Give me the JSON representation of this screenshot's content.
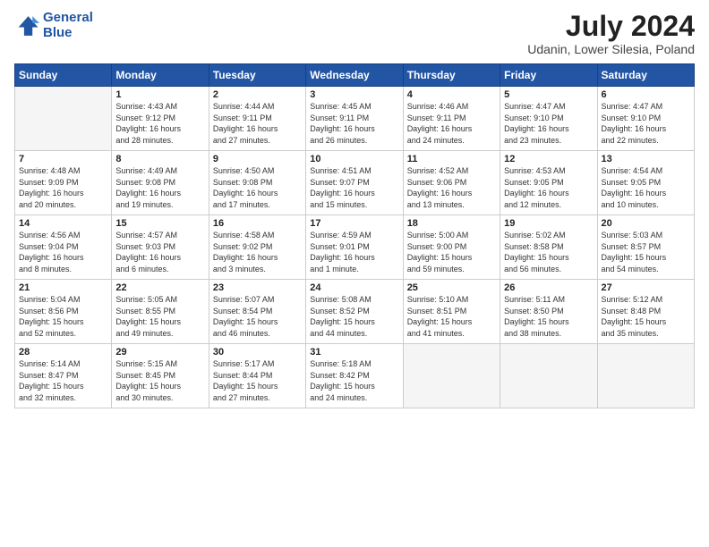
{
  "logo": {
    "line1": "General",
    "line2": "Blue"
  },
  "title": "July 2024",
  "subtitle": "Udanin, Lower Silesia, Poland",
  "days_header": [
    "Sunday",
    "Monday",
    "Tuesday",
    "Wednesday",
    "Thursday",
    "Friday",
    "Saturday"
  ],
  "weeks": [
    [
      {
        "day": "",
        "info": ""
      },
      {
        "day": "1",
        "info": "Sunrise: 4:43 AM\nSunset: 9:12 PM\nDaylight: 16 hours\nand 28 minutes."
      },
      {
        "day": "2",
        "info": "Sunrise: 4:44 AM\nSunset: 9:11 PM\nDaylight: 16 hours\nand 27 minutes."
      },
      {
        "day": "3",
        "info": "Sunrise: 4:45 AM\nSunset: 9:11 PM\nDaylight: 16 hours\nand 26 minutes."
      },
      {
        "day": "4",
        "info": "Sunrise: 4:46 AM\nSunset: 9:11 PM\nDaylight: 16 hours\nand 24 minutes."
      },
      {
        "day": "5",
        "info": "Sunrise: 4:47 AM\nSunset: 9:10 PM\nDaylight: 16 hours\nand 23 minutes."
      },
      {
        "day": "6",
        "info": "Sunrise: 4:47 AM\nSunset: 9:10 PM\nDaylight: 16 hours\nand 22 minutes."
      }
    ],
    [
      {
        "day": "7",
        "info": "Sunrise: 4:48 AM\nSunset: 9:09 PM\nDaylight: 16 hours\nand 20 minutes."
      },
      {
        "day": "8",
        "info": "Sunrise: 4:49 AM\nSunset: 9:08 PM\nDaylight: 16 hours\nand 19 minutes."
      },
      {
        "day": "9",
        "info": "Sunrise: 4:50 AM\nSunset: 9:08 PM\nDaylight: 16 hours\nand 17 minutes."
      },
      {
        "day": "10",
        "info": "Sunrise: 4:51 AM\nSunset: 9:07 PM\nDaylight: 16 hours\nand 15 minutes."
      },
      {
        "day": "11",
        "info": "Sunrise: 4:52 AM\nSunset: 9:06 PM\nDaylight: 16 hours\nand 13 minutes."
      },
      {
        "day": "12",
        "info": "Sunrise: 4:53 AM\nSunset: 9:05 PM\nDaylight: 16 hours\nand 12 minutes."
      },
      {
        "day": "13",
        "info": "Sunrise: 4:54 AM\nSunset: 9:05 PM\nDaylight: 16 hours\nand 10 minutes."
      }
    ],
    [
      {
        "day": "14",
        "info": "Sunrise: 4:56 AM\nSunset: 9:04 PM\nDaylight: 16 hours\nand 8 minutes."
      },
      {
        "day": "15",
        "info": "Sunrise: 4:57 AM\nSunset: 9:03 PM\nDaylight: 16 hours\nand 6 minutes."
      },
      {
        "day": "16",
        "info": "Sunrise: 4:58 AM\nSunset: 9:02 PM\nDaylight: 16 hours\nand 3 minutes."
      },
      {
        "day": "17",
        "info": "Sunrise: 4:59 AM\nSunset: 9:01 PM\nDaylight: 16 hours\nand 1 minute."
      },
      {
        "day": "18",
        "info": "Sunrise: 5:00 AM\nSunset: 9:00 PM\nDaylight: 15 hours\nand 59 minutes."
      },
      {
        "day": "19",
        "info": "Sunrise: 5:02 AM\nSunset: 8:58 PM\nDaylight: 15 hours\nand 56 minutes."
      },
      {
        "day": "20",
        "info": "Sunrise: 5:03 AM\nSunset: 8:57 PM\nDaylight: 15 hours\nand 54 minutes."
      }
    ],
    [
      {
        "day": "21",
        "info": "Sunrise: 5:04 AM\nSunset: 8:56 PM\nDaylight: 15 hours\nand 52 minutes."
      },
      {
        "day": "22",
        "info": "Sunrise: 5:05 AM\nSunset: 8:55 PM\nDaylight: 15 hours\nand 49 minutes."
      },
      {
        "day": "23",
        "info": "Sunrise: 5:07 AM\nSunset: 8:54 PM\nDaylight: 15 hours\nand 46 minutes."
      },
      {
        "day": "24",
        "info": "Sunrise: 5:08 AM\nSunset: 8:52 PM\nDaylight: 15 hours\nand 44 minutes."
      },
      {
        "day": "25",
        "info": "Sunrise: 5:10 AM\nSunset: 8:51 PM\nDaylight: 15 hours\nand 41 minutes."
      },
      {
        "day": "26",
        "info": "Sunrise: 5:11 AM\nSunset: 8:50 PM\nDaylight: 15 hours\nand 38 minutes."
      },
      {
        "day": "27",
        "info": "Sunrise: 5:12 AM\nSunset: 8:48 PM\nDaylight: 15 hours\nand 35 minutes."
      }
    ],
    [
      {
        "day": "28",
        "info": "Sunrise: 5:14 AM\nSunset: 8:47 PM\nDaylight: 15 hours\nand 32 minutes."
      },
      {
        "day": "29",
        "info": "Sunrise: 5:15 AM\nSunset: 8:45 PM\nDaylight: 15 hours\nand 30 minutes."
      },
      {
        "day": "30",
        "info": "Sunrise: 5:17 AM\nSunset: 8:44 PM\nDaylight: 15 hours\nand 27 minutes."
      },
      {
        "day": "31",
        "info": "Sunrise: 5:18 AM\nSunset: 8:42 PM\nDaylight: 15 hours\nand 24 minutes."
      },
      {
        "day": "",
        "info": ""
      },
      {
        "day": "",
        "info": ""
      },
      {
        "day": "",
        "info": ""
      }
    ]
  ]
}
